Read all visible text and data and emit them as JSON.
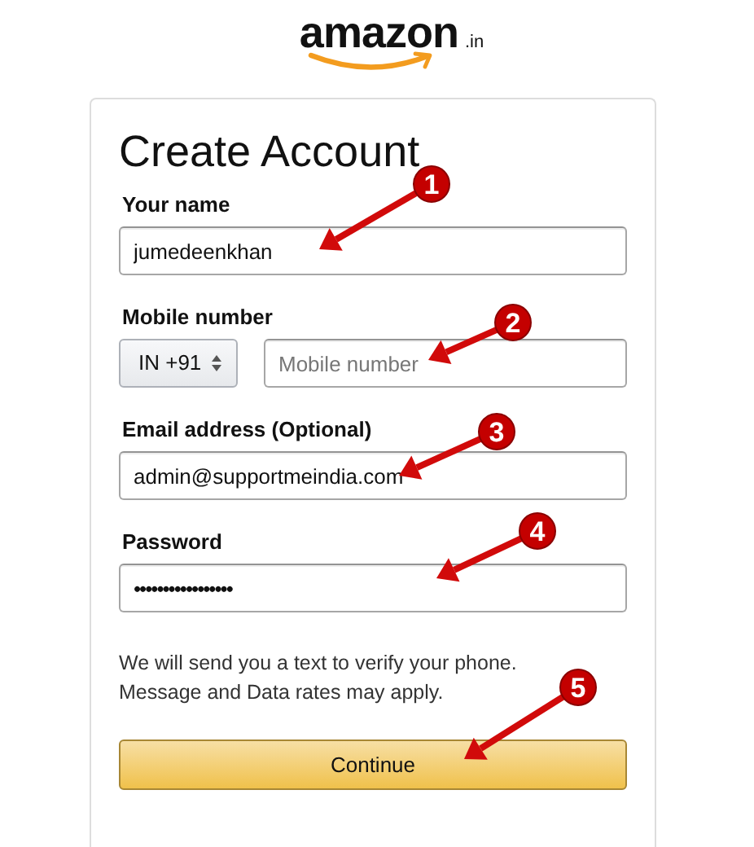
{
  "logo": {
    "wordmark": "amazon",
    "suffix": ".in"
  },
  "form": {
    "title": "Create Account",
    "fields": [
      {
        "kind": "text",
        "label": "Your name",
        "value": "jumedeenkhan"
      },
      {
        "kind": "phone",
        "label": "Mobile number",
        "country_code": "IN +91",
        "placeholder": "Mobile number"
      },
      {
        "kind": "text",
        "label": "Email address (Optional)",
        "value": "admin@supportmeindia.com"
      },
      {
        "kind": "password",
        "label": "Password",
        "value": "•••••••••••••••••"
      }
    ],
    "notice": [
      "We will send you a text to verify your phone.",
      "Message and Data rates may apply."
    ],
    "submit": "Continue"
  },
  "annotations": [
    "1",
    "2",
    "3",
    "4",
    "5"
  ]
}
